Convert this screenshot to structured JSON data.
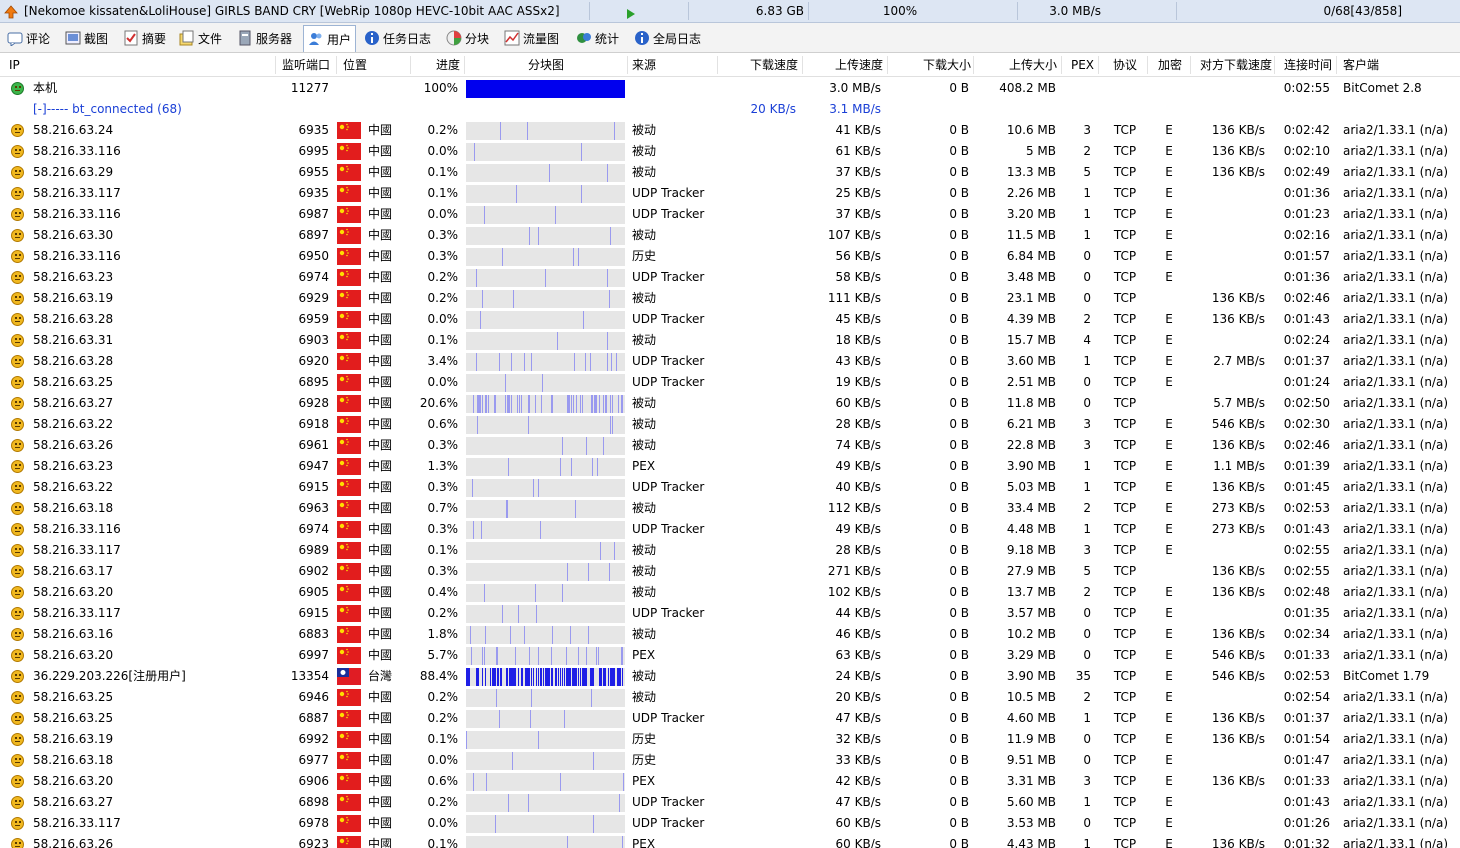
{
  "titlebar": {
    "name": "[Nekomoe kissaten&LoliHouse] GIRLS BAND CRY [WebRip 1080p HEVC-10bit AAC ASSx2]",
    "size": "6.83 GB",
    "progress": "100%",
    "speed": "3.0 MB/s",
    "peers": "0/68[43/858]"
  },
  "tabs": [
    {
      "label": "评论",
      "icon": "comment-icon"
    },
    {
      "label": "截图",
      "icon": "screenshot-icon"
    },
    {
      "label": "摘要",
      "icon": "summary-icon"
    },
    {
      "label": "文件",
      "icon": "file-icon"
    },
    {
      "label": "服务器",
      "icon": "server-icon"
    },
    {
      "label": "用户",
      "icon": "users-icon"
    },
    {
      "label": "任务日志",
      "icon": "task-log-icon"
    },
    {
      "label": "分块",
      "icon": "pieces-icon"
    },
    {
      "label": "流量图",
      "icon": "traffic-graph-icon"
    },
    {
      "label": "统计",
      "icon": "stats-icon"
    },
    {
      "label": "全局日志",
      "icon": "global-log-icon"
    }
  ],
  "active_tab": 5,
  "columns": [
    "IP",
    "监听端口",
    "位置",
    "进度",
    "分块图",
    "来源",
    "下载速度",
    "上传速度",
    "下载大小",
    "上传大小",
    "PEX",
    "协议",
    "加密",
    "对方下载速度",
    "连接时间",
    "客户端"
  ],
  "local": {
    "ip": "本机",
    "port": "11277",
    "progress": "100%",
    "progress_value": 1.0,
    "up_speed": "3.0 MB/s",
    "dl_size": "0 B",
    "up_size": "408.2 MB",
    "time": "0:02:55",
    "client": "BitComet 2.8"
  },
  "group": {
    "label": "[-]----- bt_connected (68)",
    "dl_speed": "20 KB/s",
    "up_speed": "3.1 MB/s"
  },
  "peers": [
    [
      "58.216.63.24",
      "6935",
      "中國",
      "0.2%",
      "被动",
      "41 KB/s",
      "0 B",
      "10.6 MB",
      "3",
      "TCP",
      "E",
      "136 KB/s",
      "0:02:42",
      "aria2/1.33.1 (n/a)"
    ],
    [
      "58.216.33.116",
      "6995",
      "中國",
      "0.0%",
      "被动",
      "61 KB/s",
      "0 B",
      "5 MB",
      "2",
      "TCP",
      "E",
      "136 KB/s",
      "0:02:10",
      "aria2/1.33.1 (n/a)"
    ],
    [
      "58.216.63.29",
      "6955",
      "中國",
      "0.1%",
      "被动",
      "37 KB/s",
      "0 B",
      "13.3 MB",
      "5",
      "TCP",
      "E",
      "136 KB/s",
      "0:02:49",
      "aria2/1.33.1 (n/a)"
    ],
    [
      "58.216.33.117",
      "6935",
      "中國",
      "0.1%",
      "UDP Tracker",
      "25 KB/s",
      "0 B",
      "2.26 MB",
      "1",
      "TCP",
      "E",
      "",
      "0:01:36",
      "aria2/1.33.1 (n/a)"
    ],
    [
      "58.216.33.116",
      "6987",
      "中國",
      "0.0%",
      "UDP Tracker",
      "37 KB/s",
      "0 B",
      "3.20 MB",
      "1",
      "TCP",
      "E",
      "",
      "0:01:23",
      "aria2/1.33.1 (n/a)"
    ],
    [
      "58.216.63.30",
      "6897",
      "中國",
      "0.3%",
      "被动",
      "107 KB/s",
      "0 B",
      "11.5 MB",
      "1",
      "TCP",
      "E",
      "",
      "0:02:16",
      "aria2/1.33.1 (n/a)"
    ],
    [
      "58.216.33.116",
      "6950",
      "中國",
      "0.3%",
      "历史",
      "56 KB/s",
      "0 B",
      "6.84 MB",
      "0",
      "TCP",
      "E",
      "",
      "0:01:57",
      "aria2/1.33.1 (n/a)"
    ],
    [
      "58.216.63.23",
      "6974",
      "中國",
      "0.2%",
      "UDP Tracker",
      "58 KB/s",
      "0 B",
      "3.48 MB",
      "0",
      "TCP",
      "E",
      "",
      "0:01:36",
      "aria2/1.33.1 (n/a)"
    ],
    [
      "58.216.63.19",
      "6929",
      "中國",
      "0.2%",
      "被动",
      "111 KB/s",
      "0 B",
      "23.1 MB",
      "0",
      "TCP",
      "",
      "136 KB/s",
      "0:02:46",
      "aria2/1.33.1 (n/a)"
    ],
    [
      "58.216.63.28",
      "6959",
      "中國",
      "0.0%",
      "UDP Tracker",
      "45 KB/s",
      "0 B",
      "4.39 MB",
      "2",
      "TCP",
      "E",
      "136 KB/s",
      "0:01:43",
      "aria2/1.33.1 (n/a)"
    ],
    [
      "58.216.63.31",
      "6903",
      "中國",
      "0.1%",
      "被动",
      "18 KB/s",
      "0 B",
      "15.7 MB",
      "4",
      "TCP",
      "E",
      "",
      "0:02:24",
      "aria2/1.33.1 (n/a)"
    ],
    [
      "58.216.63.28",
      "6920",
      "中國",
      "3.4%",
      "UDP Tracker",
      "43 KB/s",
      "0 B",
      "3.60 MB",
      "1",
      "TCP",
      "E",
      "2.7 MB/s",
      "0:01:37",
      "aria2/1.33.1 (n/a)"
    ],
    [
      "58.216.63.25",
      "6895",
      "中國",
      "0.0%",
      "UDP Tracker",
      "19 KB/s",
      "0 B",
      "2.51 MB",
      "0",
      "TCP",
      "E",
      "",
      "0:01:24",
      "aria2/1.33.1 (n/a)"
    ],
    [
      "58.216.63.27",
      "6928",
      "中國",
      "20.6%",
      "被动",
      "60 KB/s",
      "0 B",
      "11.8 MB",
      "0",
      "TCP",
      "",
      "5.7 MB/s",
      "0:02:50",
      "aria2/1.33.1 (n/a)"
    ],
    [
      "58.216.63.22",
      "6918",
      "中國",
      "0.6%",
      "被动",
      "28 KB/s",
      "0 B",
      "6.21 MB",
      "3",
      "TCP",
      "E",
      "546 KB/s",
      "0:02:30",
      "aria2/1.33.1 (n/a)"
    ],
    [
      "58.216.63.26",
      "6961",
      "中國",
      "0.3%",
      "被动",
      "74 KB/s",
      "0 B",
      "22.8 MB",
      "3",
      "TCP",
      "E",
      "136 KB/s",
      "0:02:46",
      "aria2/1.33.1 (n/a)"
    ],
    [
      "58.216.63.23",
      "6947",
      "中國",
      "1.3%",
      "PEX",
      "49 KB/s",
      "0 B",
      "3.90 MB",
      "1",
      "TCP",
      "E",
      "1.1 MB/s",
      "0:01:39",
      "aria2/1.33.1 (n/a)"
    ],
    [
      "58.216.63.22",
      "6915",
      "中國",
      "0.3%",
      "UDP Tracker",
      "40 KB/s",
      "0 B",
      "5.03 MB",
      "1",
      "TCP",
      "E",
      "136 KB/s",
      "0:01:45",
      "aria2/1.33.1 (n/a)"
    ],
    [
      "58.216.63.18",
      "6963",
      "中國",
      "0.7%",
      "被动",
      "112 KB/s",
      "0 B",
      "33.4 MB",
      "2",
      "TCP",
      "E",
      "273 KB/s",
      "0:02:53",
      "aria2/1.33.1 (n/a)"
    ],
    [
      "58.216.33.116",
      "6974",
      "中國",
      "0.3%",
      "UDP Tracker",
      "49 KB/s",
      "0 B",
      "4.48 MB",
      "1",
      "TCP",
      "E",
      "273 KB/s",
      "0:01:43",
      "aria2/1.33.1 (n/a)"
    ],
    [
      "58.216.33.117",
      "6989",
      "中國",
      "0.1%",
      "被动",
      "28 KB/s",
      "0 B",
      "9.18 MB",
      "3",
      "TCP",
      "E",
      "",
      "0:02:55",
      "aria2/1.33.1 (n/a)"
    ],
    [
      "58.216.63.17",
      "6902",
      "中國",
      "0.3%",
      "被动",
      "271 KB/s",
      "0 B",
      "27.9 MB",
      "5",
      "TCP",
      "",
      "136 KB/s",
      "0:02:55",
      "aria2/1.33.1 (n/a)"
    ],
    [
      "58.216.63.20",
      "6905",
      "中國",
      "0.4%",
      "被动",
      "102 KB/s",
      "0 B",
      "13.7 MB",
      "2",
      "TCP",
      "E",
      "136 KB/s",
      "0:02:48",
      "aria2/1.33.1 (n/a)"
    ],
    [
      "58.216.33.117",
      "6915",
      "中國",
      "0.2%",
      "UDP Tracker",
      "44 KB/s",
      "0 B",
      "3.57 MB",
      "0",
      "TCP",
      "E",
      "",
      "0:01:35",
      "aria2/1.33.1 (n/a)"
    ],
    [
      "58.216.63.16",
      "6883",
      "中國",
      "1.8%",
      "被动",
      "46 KB/s",
      "0 B",
      "10.2 MB",
      "0",
      "TCP",
      "E",
      "136 KB/s",
      "0:02:34",
      "aria2/1.33.1 (n/a)"
    ],
    [
      "58.216.63.20",
      "6997",
      "中國",
      "5.7%",
      "PEX",
      "63 KB/s",
      "0 B",
      "3.29 MB",
      "0",
      "TCP",
      "E",
      "546 KB/s",
      "0:01:33",
      "aria2/1.33.1 (n/a)"
    ],
    [
      "36.229.203.226[注册用户]",
      "13354",
      "台灣",
      "88.4%",
      "被动",
      "24 KB/s",
      "0 B",
      "3.90 MB",
      "35",
      "TCP",
      "E",
      "546 KB/s",
      "0:02:53",
      "BitComet 1.79"
    ],
    [
      "58.216.63.25",
      "6946",
      "中國",
      "0.2%",
      "被动",
      "20 KB/s",
      "0 B",
      "10.5 MB",
      "2",
      "TCP",
      "E",
      "",
      "0:02:54",
      "aria2/1.33.1 (n/a)"
    ],
    [
      "58.216.63.25",
      "6887",
      "中國",
      "0.2%",
      "UDP Tracker",
      "47 KB/s",
      "0 B",
      "4.60 MB",
      "1",
      "TCP",
      "E",
      "136 KB/s",
      "0:01:37",
      "aria2/1.33.1 (n/a)"
    ],
    [
      "58.216.63.19",
      "6992",
      "中國",
      "0.1%",
      "历史",
      "32 KB/s",
      "0 B",
      "11.9 MB",
      "0",
      "TCP",
      "E",
      "136 KB/s",
      "0:01:54",
      "aria2/1.33.1 (n/a)"
    ],
    [
      "58.216.63.18",
      "6977",
      "中國",
      "0.0%",
      "历史",
      "33 KB/s",
      "0 B",
      "9.51 MB",
      "0",
      "TCP",
      "E",
      "",
      "0:01:47",
      "aria2/1.33.1 (n/a)"
    ],
    [
      "58.216.63.20",
      "6906",
      "中國",
      "0.6%",
      "PEX",
      "42 KB/s",
      "0 B",
      "3.31 MB",
      "3",
      "TCP",
      "E",
      "136 KB/s",
      "0:01:33",
      "aria2/1.33.1 (n/a)"
    ],
    [
      "58.216.63.27",
      "6898",
      "中國",
      "0.2%",
      "UDP Tracker",
      "47 KB/s",
      "0 B",
      "5.60 MB",
      "1",
      "TCP",
      "E",
      "",
      "0:01:43",
      "aria2/1.33.1 (n/a)"
    ],
    [
      "58.216.33.117",
      "6978",
      "中國",
      "0.0%",
      "UDP Tracker",
      "60 KB/s",
      "0 B",
      "3.53 MB",
      "0",
      "TCP",
      "E",
      "",
      "0:01:26",
      "aria2/1.33.1 (n/a)"
    ],
    [
      "58.216.63.26",
      "6923",
      "中國",
      "0.1%",
      "PEX",
      "60 KB/s",
      "0 B",
      "4.43 MB",
      "1",
      "TCP",
      "E",
      "136 KB/s",
      "0:01:32",
      "aria2/1.33.1 (n/a)"
    ]
  ],
  "colors": {
    "piece": "#3333ff",
    "piece_bg": "#e6e6e6",
    "full": "#0000ee",
    "group_text": "#1a3fd6",
    "titlebar": "#dde6f3"
  }
}
